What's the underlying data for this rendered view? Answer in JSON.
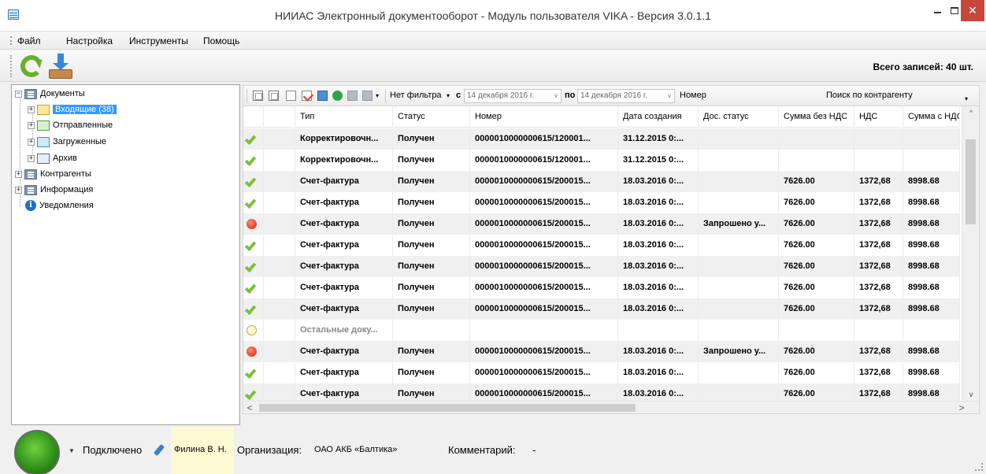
{
  "window": {
    "title": "НИИАС Электронный документооборот - Модуль пользователя VIKA - Версия 3.0.1.1",
    "close_glyph": "✕"
  },
  "menu": {
    "items": [
      "Файл",
      "Настройка",
      "Инструменты",
      "Помощь"
    ]
  },
  "toolbar": {
    "total_records": "Всего записей: 40 шт.",
    "icons": [
      "refresh-icon",
      "download-icon"
    ]
  },
  "tree": {
    "nodes": [
      {
        "label": "Документы",
        "icon": "folder-icon",
        "expander": "−"
      },
      {
        "label": "Входящие (38)",
        "icon": "mail-in-icon",
        "expander": "+",
        "selected": true
      },
      {
        "label": "Отправленные",
        "icon": "mail-sent-icon",
        "expander": "+"
      },
      {
        "label": "Загруженные",
        "icon": "mail-load-icon",
        "expander": "+"
      },
      {
        "label": "Архив",
        "icon": "archive-icon",
        "expander": "+"
      },
      {
        "label": "Контрагенты",
        "icon": "folder-icon",
        "expander": "+"
      },
      {
        "label": "Информация",
        "icon": "folder-icon",
        "expander": "+"
      },
      {
        "label": "Уведомления",
        "icon": "info-icon",
        "info_glyph": "i"
      }
    ]
  },
  "grid_toolbar": {
    "filter": "Нет фильтра",
    "from_label": "с",
    "date_from": "14 декабря  2016 г.",
    "to_label": "по",
    "date_to": "14 декабря  2016 г.",
    "number_label": "Номер",
    "counterparty_search": "Поиск по контрагенту",
    "dropdown_glyph": "▾",
    "date_arrow": "∨"
  },
  "grid": {
    "columns": [
      "",
      "Тип",
      "Статус",
      "Номер",
      "Дата создания",
      "Дос. статус",
      "Сумма без НДС",
      "НДС",
      "Сумма с НДС"
    ],
    "rows": [
      {
        "mark": "check",
        "type": "Корректировочн...",
        "status": "Получен",
        "number": "0000010000000615/120001...",
        "date": "31.12.2015 0:...",
        "doc_status": "",
        "sum_net": "",
        "vat": "",
        "sum_gross": ""
      },
      {
        "mark": "check",
        "type": "Корректировочн...",
        "status": "Получен",
        "number": "0000010000000615/120001...",
        "date": "31.12.2015 0:...",
        "doc_status": "",
        "sum_net": "",
        "vat": "",
        "sum_gross": ""
      },
      {
        "mark": "check",
        "type": "Счет-фактура",
        "status": "Получен",
        "number": "0000010000000615/200015...",
        "date": "18.03.2016 0:...",
        "doc_status": "",
        "sum_net": "7626.00",
        "vat": "1372,68",
        "sum_gross": "8998.68"
      },
      {
        "mark": "check",
        "type": "Счет-фактура",
        "status": "Получен",
        "number": "0000010000000615/200015...",
        "date": "18.03.2016 0:...",
        "doc_status": "",
        "sum_net": "7626.00",
        "vat": "1372,68",
        "sum_gross": "8998.68"
      },
      {
        "mark": "red",
        "type": "Счет-фактура",
        "status": "Получен",
        "number": "0000010000000615/200015...",
        "date": "18.03.2016 0:...",
        "doc_status": "Запрошено у...",
        "sum_net": "7626.00",
        "vat": "1372,68",
        "sum_gross": "8998.68"
      },
      {
        "mark": "check",
        "type": "Счет-фактура",
        "status": "Получен",
        "number": "0000010000000615/200015...",
        "date": "18.03.2016 0:...",
        "doc_status": "",
        "sum_net": "7626.00",
        "vat": "1372,68",
        "sum_gross": "8998.68"
      },
      {
        "mark": "check",
        "type": "Счет-фактура",
        "status": "Получен",
        "number": "0000010000000615/200015...",
        "date": "18.03.2016 0:...",
        "doc_status": "",
        "sum_net": "7626.00",
        "vat": "1372,68",
        "sum_gross": "8998.68"
      },
      {
        "mark": "check",
        "type": "Счет-фактура",
        "status": "Получен",
        "number": "0000010000000615/200015...",
        "date": "18.03.2016 0:...",
        "doc_status": "",
        "sum_net": "7626.00",
        "vat": "1372,68",
        "sum_gross": "8998.68"
      },
      {
        "mark": "check",
        "type": "Счет-фактура",
        "status": "Получен",
        "number": "0000010000000615/200015...",
        "date": "18.03.2016 0:...",
        "doc_status": "",
        "sum_net": "7626.00",
        "vat": "1372,68",
        "sum_gross": "8998.68"
      },
      {
        "mark": "yellow",
        "type": "Остальные доку...",
        "status": "",
        "number": "",
        "date": "",
        "doc_status": "",
        "sum_net": "",
        "vat": "",
        "sum_gross": "",
        "muted": true
      },
      {
        "mark": "red",
        "type": "Счет-фактура",
        "status": "Получен",
        "number": "0000010000000615/200015...",
        "date": "18.03.2016 0:...",
        "doc_status": "Запрошено у...",
        "sum_net": "7626.00",
        "vat": "1372,68",
        "sum_gross": "8998.68"
      },
      {
        "mark": "check",
        "type": "Счет-фактура",
        "status": "Получен",
        "number": "0000010000000615/200015...",
        "date": "18.03.2016 0:...",
        "doc_status": "",
        "sum_net": "7626.00",
        "vat": "1372,68",
        "sum_gross": "8998.68"
      },
      {
        "mark": "check",
        "type": "Счет-фактура",
        "status": "Получен",
        "number": "0000010000000615/200015...",
        "date": "18.03.2016 0:...",
        "doc_status": "",
        "sum_net": "7626.00",
        "vat": "1372,68",
        "sum_gross": "8998.68"
      }
    ],
    "scroll_up": "^",
    "scroll_down": "∨",
    "scroll_left": "<",
    "scroll_right": ">"
  },
  "status_bar": {
    "connection": "Подключено",
    "user": "Филина В. Н.",
    "org_label": "Организация:",
    "org_value": "ОАО АКБ «Балтика»",
    "comment_label": "Комментарий:",
    "comment_value": "-",
    "dropdown_glyph": "▼"
  },
  "colors": {
    "selection": "#3399ff",
    "close_button": "#c9463d",
    "status_ok": "#7dbf3c",
    "status_error": "#d2230f",
    "connected_led": "#2e8d17"
  }
}
